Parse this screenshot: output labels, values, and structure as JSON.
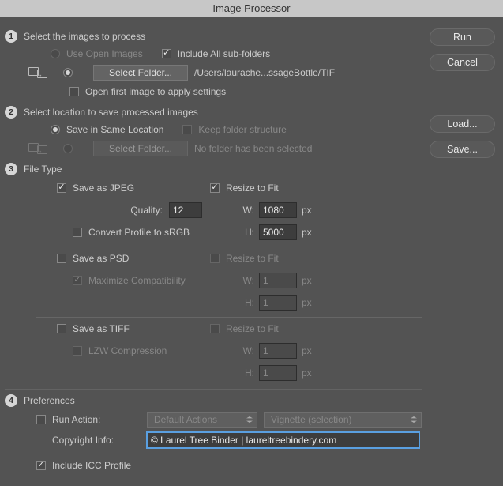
{
  "title": "Image Processor",
  "buttons": {
    "run": "Run",
    "cancel": "Cancel",
    "load": "Load...",
    "save": "Save..."
  },
  "section1": {
    "num": "1",
    "title": "Select the images to process",
    "useOpen": "Use Open Images",
    "includeSub": "Include All sub-folders",
    "selectFolder": "Select Folder...",
    "path": "/Users/laurache...ssageBottle/TIF",
    "openFirst": "Open first image to apply settings"
  },
  "section2": {
    "num": "2",
    "title": "Select location to save processed images",
    "saveSame": "Save in Same Location",
    "keepStruct": "Keep folder structure",
    "selectFolder": "Select Folder...",
    "noFolder": "No folder has been selected"
  },
  "section3": {
    "num": "3",
    "title": "File Type",
    "jpeg": {
      "label": "Save as JPEG",
      "quality": "Quality:",
      "qualityVal": "12",
      "convert": "Convert Profile to sRGB",
      "resize": "Resize to Fit",
      "w": "W:",
      "wVal": "1080",
      "h": "H:",
      "hVal": "5000",
      "px": "px"
    },
    "psd": {
      "label": "Save as PSD",
      "maxCompat": "Maximize Compatibility",
      "resize": "Resize to Fit",
      "w": "W:",
      "wVal": "1",
      "h": "H:",
      "hVal": "1",
      "px": "px"
    },
    "tiff": {
      "label": "Save as TIFF",
      "lzw": "LZW Compression",
      "resize": "Resize to Fit",
      "w": "W:",
      "wVal": "1",
      "h": "H:",
      "hVal": "1",
      "px": "px"
    }
  },
  "section4": {
    "num": "4",
    "title": "Preferences",
    "runAction": "Run Action:",
    "actionSet": "Default Actions",
    "action": "Vignette (selection)",
    "copyright": "Copyright Info:",
    "copyrightVal": "© Laurel Tree Binder | laureltreebindery.com",
    "icc": "Include ICC Profile"
  }
}
